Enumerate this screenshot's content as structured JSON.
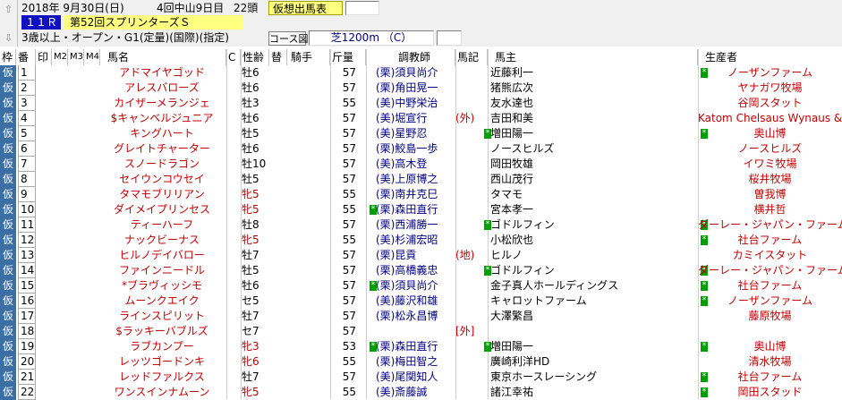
{
  "nav": {
    "up": "⇧",
    "down": "⇩"
  },
  "header": {
    "date": "2018年  9月30日(日)",
    "meeting": "4回中山9日目",
    "heads": "22頭",
    "status": "仮想出馬表",
    "race_no": "１１Ｒ",
    "race_name": "第52回スプリンターズＳ",
    "conditions": "3歳以上・オープン・G1(定量)(国際)(指定)",
    "course_label": "コース図",
    "course": "芝1200m （C）"
  },
  "columns": {
    "waku": "枠",
    "ban": "番",
    "in": "印",
    "m2": "M2",
    "m3": "M3",
    "m4": "M4",
    "horse": "馬名",
    "c": "C",
    "sexage": "性齢",
    "kae": "替",
    "jockey": "騎手",
    "kin": "斤量",
    "trainer": "調教師",
    "note": "馬記",
    "owner": "馬主",
    "breeder": "生産者"
  },
  "rows": [
    {
      "waku": "仮",
      "ban": "1",
      "horse": "アドマイヤゴッド",
      "sex": "牡6",
      "kin": "57",
      "mk": "",
      "tr": "(栗)須貝尚介",
      "note": "",
      "owner": "近藤利一",
      "mk2": "*",
      "brd": "ノーザンファーム",
      "sexred": false
    },
    {
      "waku": "仮",
      "ban": "2",
      "horse": "アレスバローズ",
      "sex": "牡6",
      "kin": "57",
      "mk": "",
      "tr": "(栗)角田晃一",
      "note": "",
      "owner": "猪熊広次",
      "mk2": "",
      "brd": "ヤナガワ牧場",
      "sexred": false
    },
    {
      "waku": "仮",
      "ban": "3",
      "horse": "カイザーメランジェ",
      "sex": "牡3",
      "kin": "55",
      "mk": "",
      "tr": "(美)中野栄治",
      "note": "",
      "owner": "友水達也",
      "mk2": "",
      "brd": "谷岡スタット",
      "sexred": false
    },
    {
      "waku": "仮",
      "ban": "4",
      "horse": "$キャンベルジュニア",
      "sex": "牡6",
      "kin": "57",
      "mk": "",
      "tr": "(美)堀宣行",
      "note": "(外)",
      "owner": "吉田和美",
      "mk2": "",
      "brd": "Katom Chelsaus Wynaus &",
      "sexred": false
    },
    {
      "waku": "仮",
      "ban": "5",
      "horse": "キングハート",
      "sex": "牡5",
      "kin": "57",
      "mk": "",
      "tr": "(美)星野忍",
      "note": "",
      "owner": "増田陽一",
      "mk2": "*",
      "brd": "奥山博",
      "sexred": false,
      "mkown": "*"
    },
    {
      "waku": "仮",
      "ban": "6",
      "horse": "グレイトチャーター",
      "sex": "牡6",
      "kin": "57",
      "mk": "",
      "tr": "(栗)鮫島一歩",
      "note": "",
      "owner": "ノースヒルズ",
      "mk2": "",
      "brd": "ノースヒルズ",
      "sexred": false
    },
    {
      "waku": "仮",
      "ban": "7",
      "horse": "スノードラゴン",
      "sex": "牡10",
      "kin": "57",
      "mk": "",
      "tr": "(美)高木登",
      "note": "",
      "owner": "岡田牧雄",
      "mk2": "",
      "brd": "イワミ牧場",
      "sexred": false
    },
    {
      "waku": "仮",
      "ban": "8",
      "horse": "セイウンコウセイ",
      "sex": "牡5",
      "kin": "57",
      "mk": "",
      "tr": "(美)上原博之",
      "note": "",
      "owner": "西山茂行",
      "mk2": "",
      "brd": "桜井牧場",
      "sexred": false
    },
    {
      "waku": "仮",
      "ban": "9",
      "horse": "タマモブリリアン",
      "sex": "牝5",
      "kin": "55",
      "mk": "",
      "tr": "(栗)南井克巳",
      "note": "",
      "owner": "タマモ",
      "mk2": "",
      "brd": "曽我博",
      "sexred": true
    },
    {
      "waku": "仮",
      "ban": "10",
      "horse": "ダイメイプリンセス",
      "sex": "牝5",
      "kin": "55",
      "mk": "*",
      "tr": "(栗)森田直行",
      "note": "",
      "owner": "宮本孝一",
      "mk2": "",
      "brd": "横井哲",
      "sexred": true
    },
    {
      "waku": "仮",
      "ban": "11",
      "horse": "ティーハーフ",
      "sex": "牡8",
      "kin": "57",
      "mk": "",
      "tr": "(栗)西浦勝一",
      "note": "",
      "owner": "ゴドルフィン",
      "mk2": "*",
      "brd": "ダーレー・ジャパン・ファーム",
      "sexred": false,
      "mkown": "*"
    },
    {
      "waku": "仮",
      "ban": "12",
      "horse": "ナックビーナス",
      "sex": "牝5",
      "kin": "55",
      "mk": "",
      "tr": "(美)杉浦宏昭",
      "note": "",
      "owner": "小松欣也",
      "mk2": "*",
      "brd": "社台ファーム",
      "sexred": true
    },
    {
      "waku": "仮",
      "ban": "13",
      "horse": "ヒルノデイバロー",
      "sex": "牡7",
      "kin": "57",
      "mk": "",
      "tr": "(栗)昆貢",
      "note": "(地)",
      "owner": "ヒルノ",
      "mk2": "",
      "brd": "カミイスタット",
      "sexred": false
    },
    {
      "waku": "仮",
      "ban": "14",
      "horse": "ファインニードル",
      "sex": "牡5",
      "kin": "57",
      "mk": "",
      "tr": "(栗)高橋義忠",
      "note": "",
      "owner": "ゴドルフィン",
      "mk2": "*",
      "brd": "ダーレー・ジャパン・ファーム",
      "sexred": false,
      "mkown": "*"
    },
    {
      "waku": "仮",
      "ban": "15",
      "horse": "*ブラヴィッシモ",
      "sex": "牡6",
      "kin": "57",
      "mk": "*",
      "tr": "(栗)須貝尚介",
      "note": "",
      "owner": "金子真人ホールディングス",
      "mk2": "*",
      "brd": "社台ファーム",
      "sexred": false
    },
    {
      "waku": "仮",
      "ban": "16",
      "horse": "ムーンクエイク",
      "sex": "セ5",
      "kin": "57",
      "mk": "",
      "tr": "(美)藤沢和雄",
      "note": "",
      "owner": "キャロットファーム",
      "mk2": "*",
      "brd": "ノーザンファーム",
      "sexred": false
    },
    {
      "waku": "仮",
      "ban": "17",
      "horse": "ラインスピリット",
      "sex": "牡7",
      "kin": "57",
      "mk": "",
      "tr": "(栗)松永昌博",
      "note": "",
      "owner": "大澤繁昌",
      "mk2": "",
      "brd": "藤原牧場",
      "sexred": false
    },
    {
      "waku": "仮",
      "ban": "18",
      "horse": "$ラッキーバブルズ",
      "sex": "セ7",
      "kin": "57",
      "mk": "",
      "tr": "",
      "note": "[外]",
      "owner": "",
      "mk2": "",
      "brd": "",
      "sexred": false
    },
    {
      "waku": "仮",
      "ban": "19",
      "horse": "ラブカンプー",
      "sex": "牝3",
      "kin": "53",
      "mk": "*",
      "tr": "(栗)森田直行",
      "note": "",
      "owner": "増田陽一",
      "mk2": "*",
      "brd": "奥山博",
      "sexred": true,
      "mkown": "*"
    },
    {
      "waku": "仮",
      "ban": "20",
      "horse": "レッツゴードンキ",
      "sex": "牝6",
      "kin": "55",
      "mk": "",
      "tr": "(栗)梅田智之",
      "note": "",
      "owner": "廣崎利洋HD",
      "mk2": "",
      "brd": "清水牧場",
      "sexred": true
    },
    {
      "waku": "仮",
      "ban": "21",
      "horse": "レッドファルクス",
      "sex": "牡7",
      "kin": "57",
      "mk": "",
      "tr": "(美)尾関知人",
      "note": "",
      "owner": "東京ホースレーシング",
      "mk2": "*",
      "brd": "社台ファーム",
      "sexred": false
    },
    {
      "waku": "仮",
      "ban": "22",
      "horse": "ワンスインナムーン",
      "sex": "牝5",
      "kin": "55",
      "mk": "",
      "tr": "(美)斎藤誠",
      "note": "",
      "owner": "諸江幸祐",
      "mk2": "*",
      "brd": "岡田スタッド",
      "sexred": true
    }
  ]
}
